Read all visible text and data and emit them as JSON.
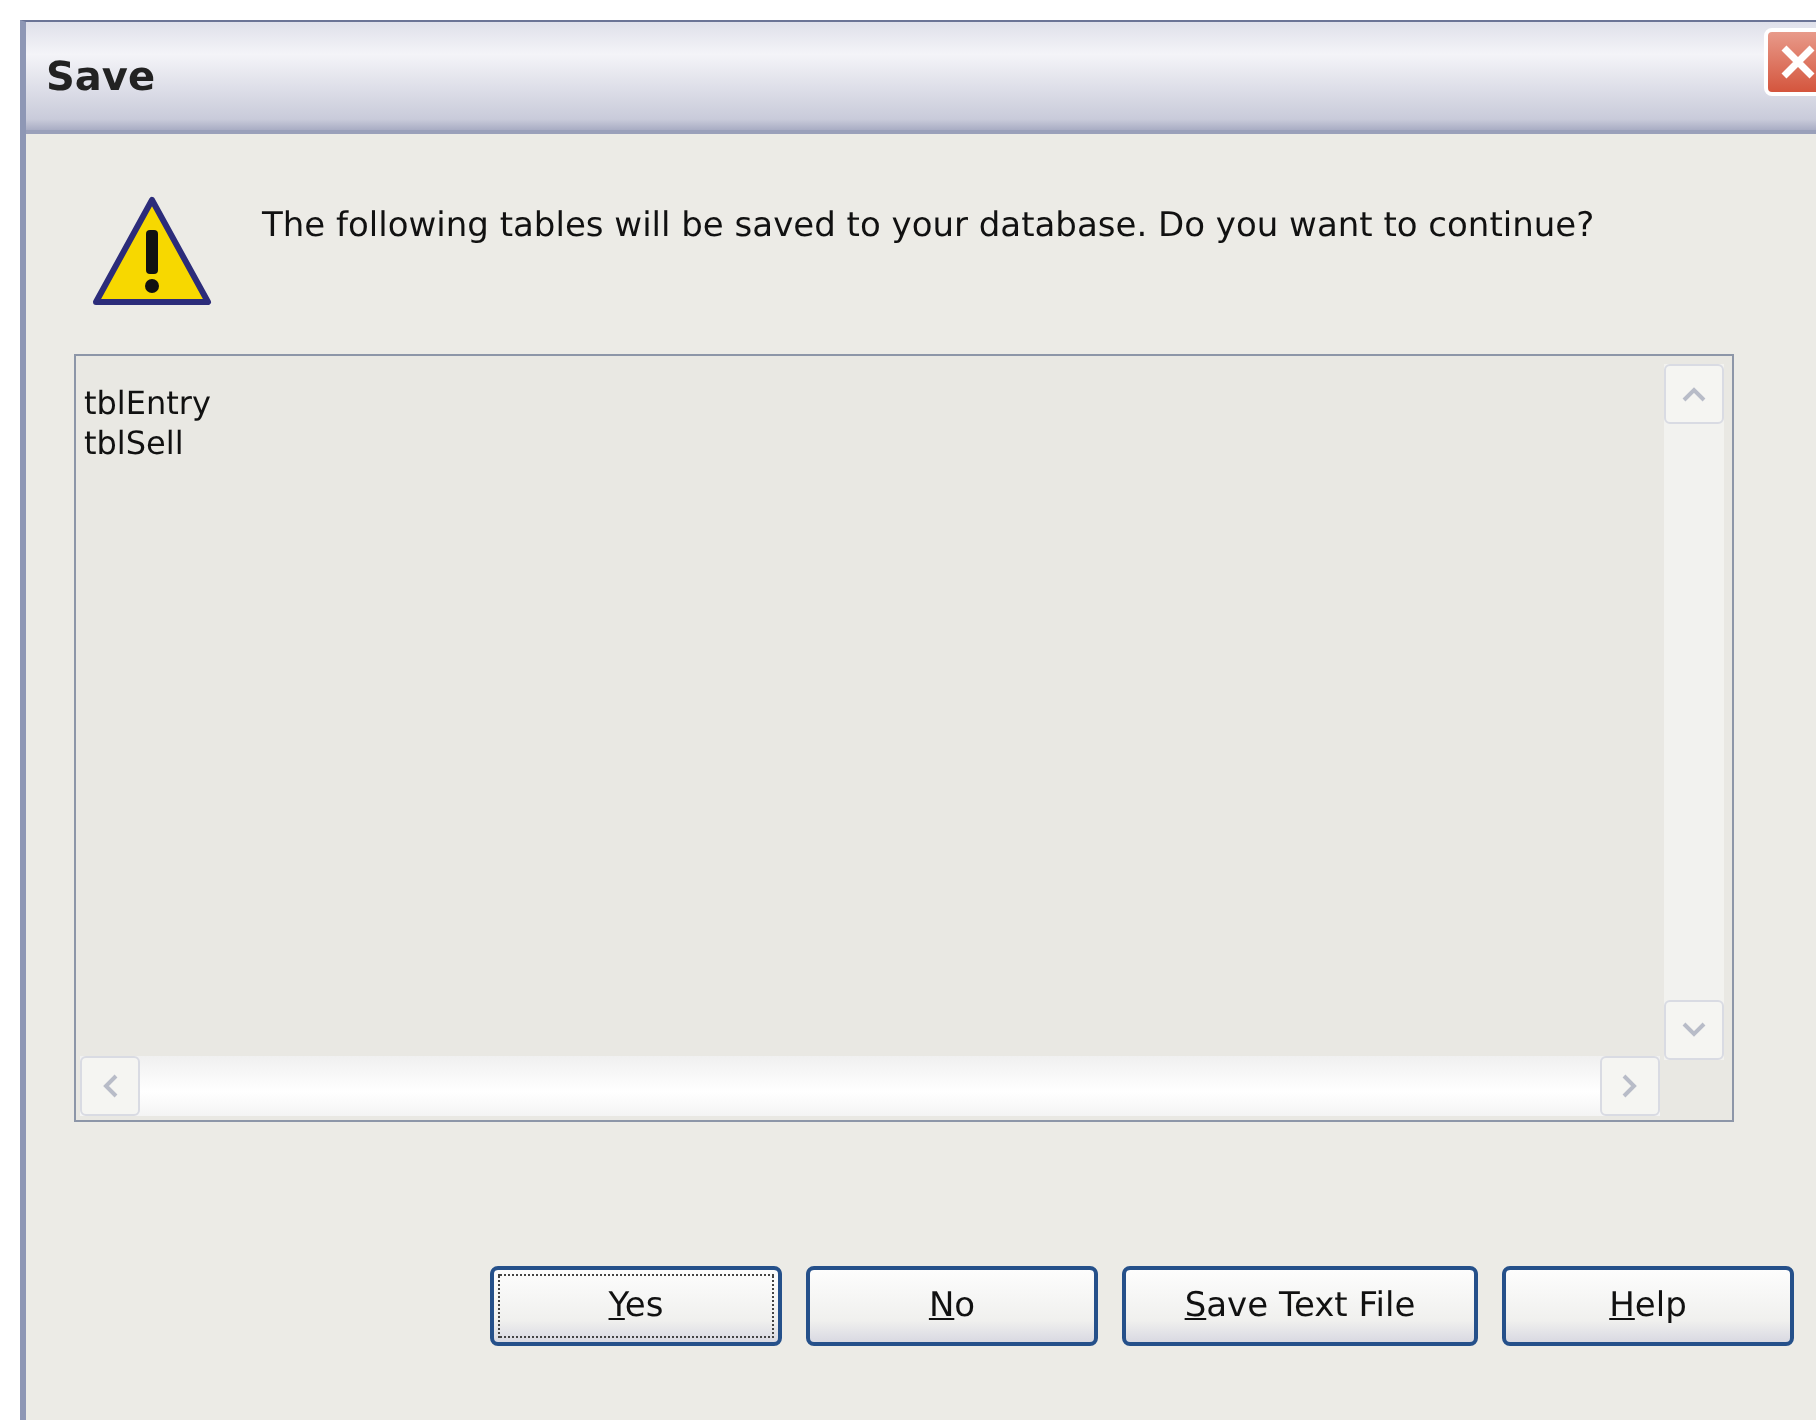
{
  "window": {
    "title": "Save"
  },
  "message": "The following tables will be saved to your database. Do you want to continue?",
  "tables": [
    "tblEntry",
    "tblSell"
  ],
  "buttons": [
    {
      "key": "Y",
      "rest": "es",
      "focused": true
    },
    {
      "key": "N",
      "rest": "o",
      "focused": false
    },
    {
      "key": "S",
      "rest": "ave Text File",
      "focused": false
    },
    {
      "key": "H",
      "rest": "elp",
      "focused": false
    }
  ]
}
